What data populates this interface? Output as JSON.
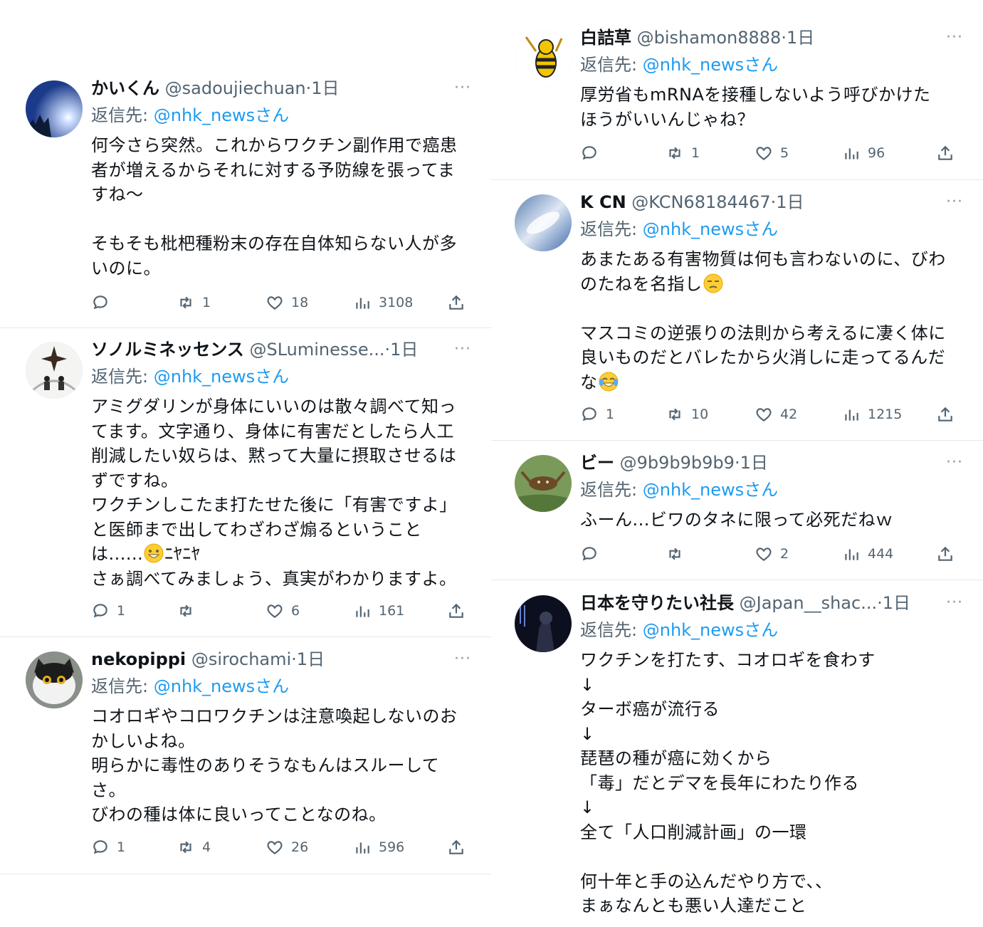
{
  "reply_prefix": "返信先:",
  "reply_suffix": "さん",
  "more_label": "···",
  "colors": {
    "link": "#1d9bf0",
    "secondary": "#536471",
    "separator": "#e4e7ea"
  },
  "tweets": [
    {
      "name": "かいくん",
      "handle": "@sadoujiechuan",
      "time": "·1日",
      "reply_to": "@nhk_news",
      "text": "何今さら突然。これからワクチン副作用で癌患\n者が増えるからそれに対する予防線を張ってま\nすね〜\n\nそもそも枇杷種粉末の存在自体知らない人が多\nいのに。",
      "reply_count": "",
      "retweet_count": "1",
      "like_count": "18",
      "view_count": "3108"
    },
    {
      "name": "ソノルミネッセンス",
      "handle": "@SLuminesse...",
      "time": "·1日",
      "reply_to": "@nhk_news",
      "text_before_emoji": "アミグダリンが身体にいいのは散々調べて知っ\nてます。文字通り、身体に有害だとしたら人工\n削減したい奴らは、黙って大量に摂取させるは\nずですね。\nワクチンしこたま打たせた後に「有害ですよ」\nと医師まで出してわざわざ煽るということ\nは......",
      "text_after_emoji": "ﾆﾔﾆﾔ\nさぁ調べてみましょう、真実がわかりますよ。",
      "reply_count": "1",
      "retweet_count": "",
      "like_count": "6",
      "view_count": "161"
    },
    {
      "name": "nekopippi",
      "handle": "@sirochami",
      "time": "·1日",
      "reply_to": "@nhk_news",
      "text": "コオロギやコロワクチンは注意喚起しないのお\nかしいよね。\n明らかに毒性のありそうなもんはスルーして\nさ。\nびわの種は体に良いってことなのね。",
      "reply_count": "1",
      "retweet_count": "4",
      "like_count": "26",
      "view_count": "596"
    },
    {
      "name": "白詰草",
      "handle": "@bishamon8888",
      "time": "·1日",
      "reply_to": "@nhk_news",
      "text": "厚労省もmRNAを接種しないよう呼びかけた\nほうがいいんじゃね？",
      "reply_count": "",
      "retweet_count": "1",
      "like_count": "5",
      "view_count": "96"
    },
    {
      "name": "K CN",
      "handle": "@KCN68184467",
      "time": "·1日",
      "reply_to": "@nhk_news",
      "text_line1": "あまたある有害物質は何も言わないのに、びわ",
      "text_line2": "のたねを名指し",
      "text_rest": "\nマスコミの逆張りの法則から考えるに凄く体に\n良いものだとバレたから火消しに走ってるんだ",
      "text_last": "な",
      "reply_count": "1",
      "retweet_count": "10",
      "like_count": "42",
      "view_count": "1215"
    },
    {
      "name": "ビー",
      "handle": "@9b9b9b9b9",
      "time": "·1日",
      "reply_to": "@nhk_news",
      "text": "ふーん...ビワのタネに限って必死だねｗ",
      "reply_count": "",
      "retweet_count": "",
      "like_count": "2",
      "view_count": "444"
    },
    {
      "name": "日本を守りたい社長",
      "handle": "@Japan__shac...",
      "time": "·1日",
      "reply_to": "@nhk_news",
      "text": "ワクチンを打たす、コオロギを食わす\n↓\nターボ癌が流行る\n↓\n琵琶の種が癌に効くから\n「毒」だとデマを長年にわたり作る\n↓\n全て「人口削減計画」の一環\n\n何十年と手の込んだやり方で、、\nまぁなんとも悪い人達だこと"
    }
  ]
}
